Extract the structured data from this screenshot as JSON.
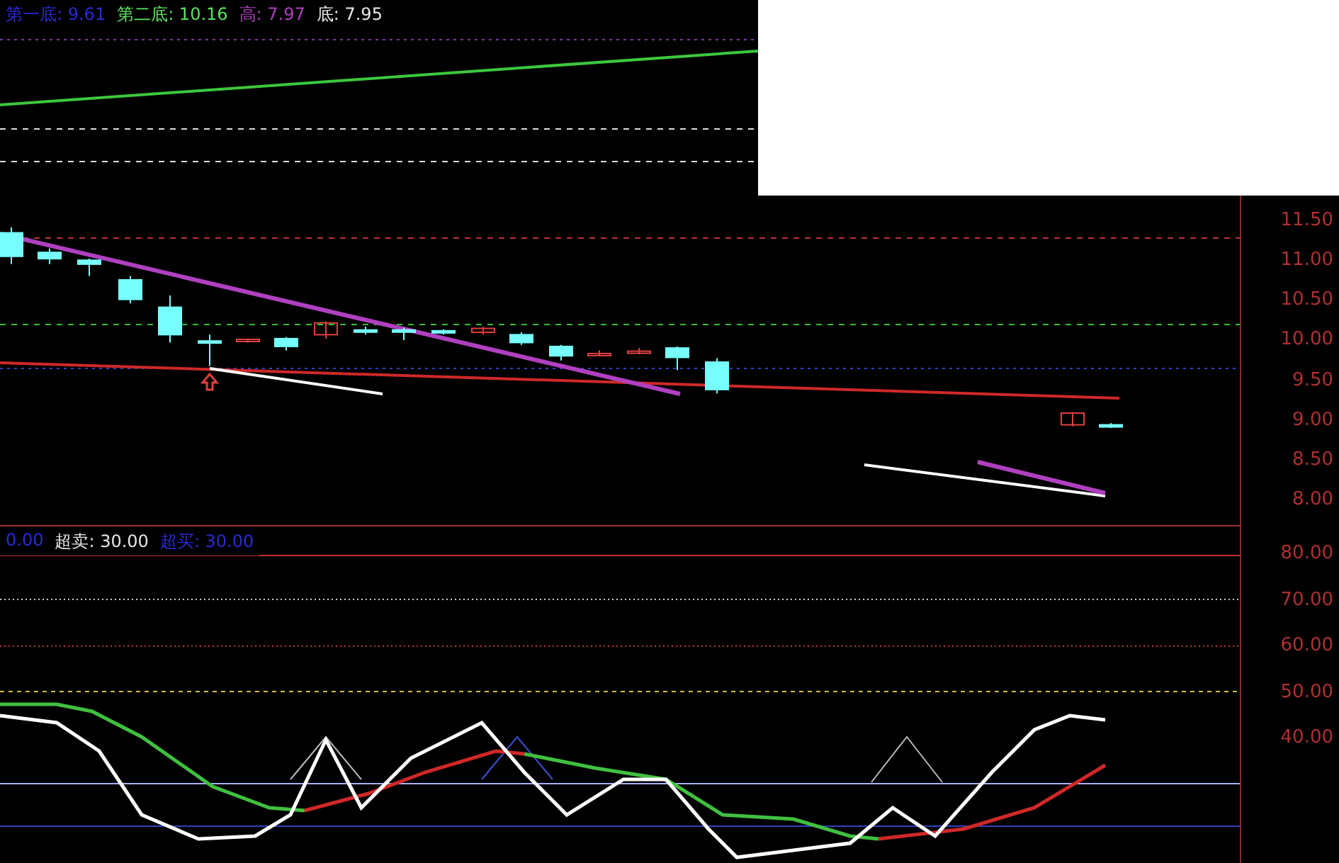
{
  "top_panel": {
    "legend": [
      {
        "text": "第一底: 9.61",
        "color": "#2a2ad8"
      },
      {
        "text": "第二底: 10.16",
        "color": "#5ee05e"
      },
      {
        "text": "高: 7.97",
        "color": "#b040c0"
      },
      {
        "text": "底: 7.95",
        "color": "#e8e8e8"
      }
    ]
  },
  "price_axis": {
    "ticks": [
      "11.50",
      "11.00",
      "10.50",
      "10.00",
      "9.50",
      "9.00",
      "8.50",
      "8.00"
    ]
  },
  "indicator_panel": {
    "legend": [
      {
        "text": "0.00",
        "color": "#2a2ad8"
      },
      {
        "text": "超卖: 30.00",
        "color": "#e8e8e8"
      },
      {
        "text": "超买: 30.00",
        "color": "#2a2ad8"
      }
    ]
  },
  "indicator_axis": {
    "ticks": [
      "80.00",
      "70.00",
      "60.00",
      "50.00",
      "40.00"
    ]
  }
}
